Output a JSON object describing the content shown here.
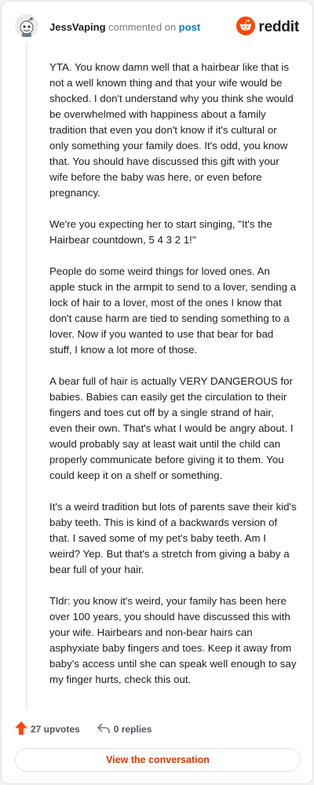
{
  "comment": {
    "author": "JessVaping",
    "action_text": "commented on",
    "post_link_text": "post",
    "avatar_icon": "snoo-avatar-icon",
    "paragraphs": [
      "YTA. You know damn well that a hairbear like that is not a well known thing and that your wife would be shocked. I don't understand why you think she would be overwhelmed with happiness about a family tradition that even you don't know if it's cultural or only something your family does. It's odd, you know that. You should have discussed this gift with your wife before the baby was here, or even before pregnancy.",
      "We're you expecting her to start singing, \"It's the Hairbear countdown, 5 4 3 2 1!\"",
      "People do some weird things for loved ones. An apple stuck in the armpit to send to a lover, sending a lock of hair to a lover, most of the ones I know that don't cause harm are tied to sending something to a lover. Now if you wanted to use that bear for bad stuff, I know a lot more of those.",
      "A bear full of hair is actually VERY DANGEROUS for babies. Babies can easily get the circulation to their fingers and toes cut off by a single strand of hair, even their own. That's what I would be angry about. I would probably say at least wait until the child can properly communicate before giving it to them. You could keep it on a shelf or something.",
      "It's a weird tradition but lots of parents save their kid's baby teeth. This is kind of a backwards version of that. I saved some of my pet's baby teeth. Am I weird? Yep. But that's a stretch from giving a baby a bear full of your hair.",
      "Tldr: you know it's weird, your family has been here over 100 years, you should have discussed this with your wife. Hairbears and non-bear hairs can asphyxiate baby fingers and toes. Keep it away from baby's access until she can speak well enough to say my finger hurts, check this out."
    ]
  },
  "brand": {
    "name": "reddit",
    "logo_icon": "reddit-logo-icon",
    "color": "#ff4500"
  },
  "footer": {
    "upvotes_label": "27 upvotes",
    "upvote_icon": "upvote-arrow-icon",
    "upvote_color": "#ff4500",
    "replies_label": "0 replies",
    "reply_icon": "reply-icon"
  },
  "cta": {
    "label": "View the conversation",
    "color": "#d93a00"
  }
}
